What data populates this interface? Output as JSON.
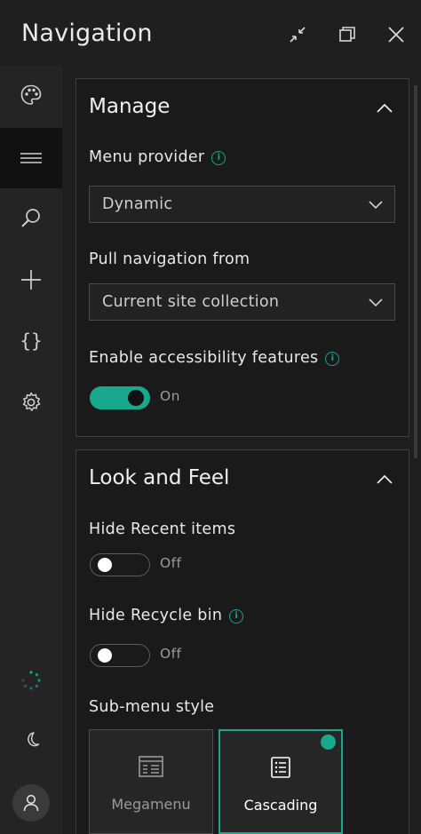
{
  "window": {
    "title": "Navigation",
    "controls": {
      "minimize": "shrink-icon",
      "restore": "restore-icon",
      "close": "close-icon"
    }
  },
  "rail": {
    "items": [
      {
        "icon": "palette-icon"
      },
      {
        "icon": "menu-lines-icon",
        "active": true
      },
      {
        "icon": "search-icon"
      },
      {
        "icon": "plus-icon"
      },
      {
        "icon": "braces-icon",
        "glyph": "{}"
      },
      {
        "icon": "gear-icon"
      }
    ],
    "bottom": [
      {
        "icon": "loading-spinner-icon"
      },
      {
        "icon": "moon-icon"
      },
      {
        "icon": "user-icon"
      }
    ]
  },
  "manage": {
    "title": "Manage",
    "menu_provider": {
      "label": "Menu provider",
      "value": "Dynamic"
    },
    "pull_from": {
      "label": "Pull navigation from",
      "value": "Current site collection"
    },
    "accessibility": {
      "label": "Enable accessibility features",
      "state": "On"
    }
  },
  "look": {
    "title": "Look and Feel",
    "hide_recent": {
      "label": "Hide Recent items",
      "state": "Off"
    },
    "hide_recycle": {
      "label": "Hide Recycle bin",
      "state": "Off"
    },
    "submenu": {
      "label": "Sub-menu style",
      "options": [
        {
          "label": "Megamenu"
        },
        {
          "label": "Cascading",
          "selected": true
        }
      ]
    }
  },
  "colors": {
    "accent": "#17a88d",
    "background": "#1b1b1b",
    "panel": "#1a1a1a"
  }
}
